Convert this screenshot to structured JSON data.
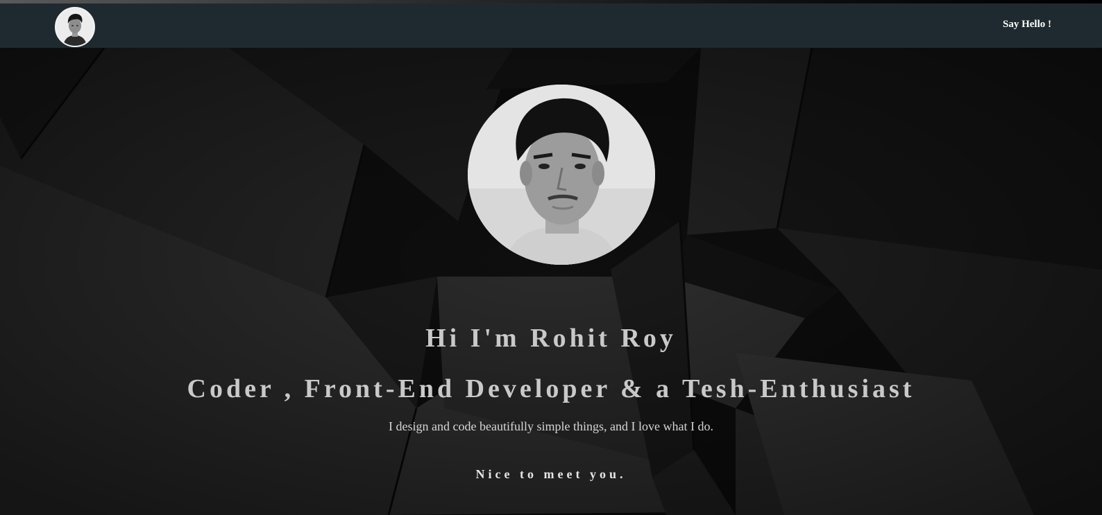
{
  "navbar": {
    "avatar_alt": "Profile photo",
    "say_hello_label": "Say Hello !"
  },
  "hero": {
    "greeting": "Hi I'm Rohit Roy",
    "tagline": "Coder , Front-End Developer & a Tesh-Enthusiast",
    "description": "I design and code beautifully simple things, and I love what I do.",
    "closing": "Nice to meet you."
  },
  "colors": {
    "navbar_bg": "#1f2a30",
    "hero_bg": "#0d0d0d",
    "text_light": "#c9c9c9",
    "link": "#ffffff"
  },
  "icons": {
    "avatar": "person-portrait"
  }
}
